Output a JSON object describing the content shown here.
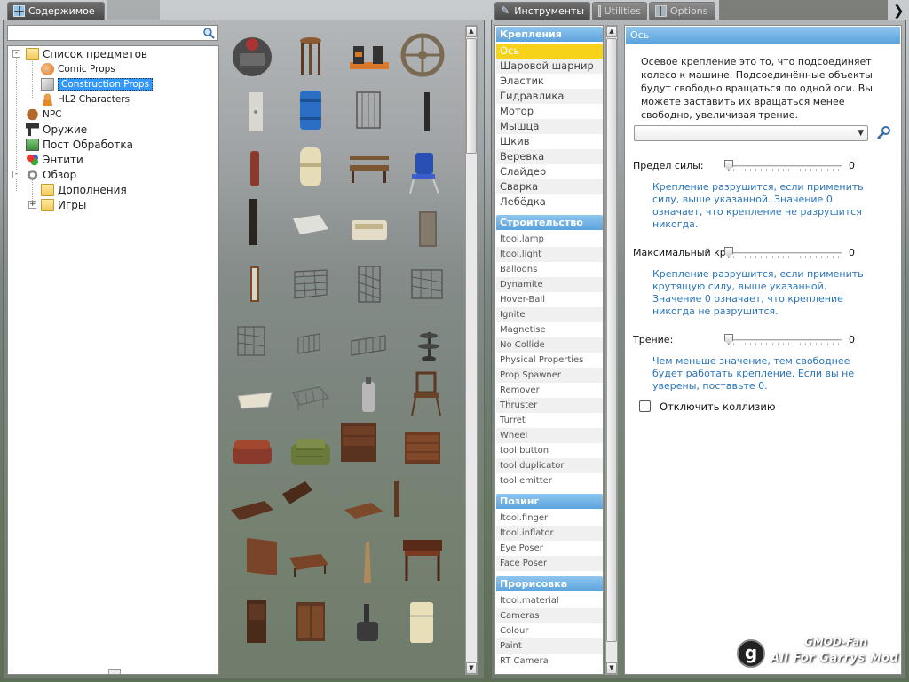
{
  "left_tab": {
    "label": "Содержимое"
  },
  "right_tabs": [
    {
      "label": "Инструменты",
      "active": true
    },
    {
      "label": "Utilities",
      "active": false
    },
    {
      "label": "Options",
      "active": false
    }
  ],
  "search": {
    "value": "",
    "placeholder": ""
  },
  "tree": {
    "items": [
      {
        "label": "Список предметов",
        "icon": "folder-icon",
        "expander": "-"
      },
      {
        "label": "Comic Props",
        "icon": "props-icon"
      },
      {
        "label": "Construction Props",
        "icon": "props-icon",
        "selected": true
      },
      {
        "label": "HL2 Characters",
        "icon": "character-icon"
      },
      {
        "label": "NPC",
        "icon": "npc-icon"
      },
      {
        "label": "Оружие",
        "icon": "weapon-icon"
      },
      {
        "label": "Пост Обработка",
        "icon": "postprocess-icon"
      },
      {
        "label": "Энтити",
        "icon": "entity-icon"
      },
      {
        "label": "Обзор",
        "icon": "gear-icon",
        "expander": "-"
      },
      {
        "label": "Дополнения",
        "icon": "folder-icon"
      },
      {
        "label": "Игры",
        "icon": "folder-icon",
        "expander": "+"
      }
    ]
  },
  "tools": {
    "categories": [
      {
        "title": "Крепления",
        "items": [
          "Ось",
          "Шаровой шарнир",
          "Эластик",
          "Гидравлика",
          "Мотор",
          "Мышца",
          "Шкив",
          "Веревка",
          "Слайдер",
          "Сварка",
          "Лебёдка"
        ]
      },
      {
        "title": "Строительство",
        "items": [
          "ltool.lamp",
          "ltool.light",
          "Balloons",
          "Dynamite",
          "Hover-Ball",
          "Ignite",
          "Magnetise",
          "No Collide",
          "Physical Properties",
          "Prop Spawner",
          "Remover",
          "Thruster",
          "Turret",
          "Wheel",
          "tool.button",
          "tool.duplicator",
          "tool.emitter"
        ]
      },
      {
        "title": "Позинг",
        "items": [
          "ltool.finger",
          "ltool.inflator",
          "Eye Poser",
          "Face Poser"
        ]
      },
      {
        "title": "Прорисовка",
        "items": [
          "ltool.material",
          "Cameras",
          "Colour",
          "Paint",
          "RT Camera"
        ]
      }
    ],
    "selected": "Ось"
  },
  "settings": {
    "title": "Ось",
    "description": "Осевое крепление это то, что подсоединяет колесо к машине. Подсоединённые объекты будут свободно вращаться по одной оси. Вы можете заставить их вращаться менее свободно, увеличивая трение.",
    "dropdown_value": "",
    "sliders": [
      {
        "label": "Предел силы:",
        "value": "0",
        "fraction": 0,
        "help": "Крепление разрушится, если применить силу, выше указанной. Значение 0 означает, что крепление не разрушится никогда."
      },
      {
        "label": "Максимальный кр",
        "value": "0",
        "fraction": 0,
        "help": "Крепление разрушится, если применить крутящую силу, выше указанной. Значение 0 означает, что крепление никогда не разрушится."
      },
      {
        "label": "Трение:",
        "value": "0",
        "fraction": 0,
        "help": "Чем меньше значение, тем свободнее будет работать крепление. Если вы не уверены, поставьте 0."
      }
    ],
    "checkbox": {
      "label": "Отключить коллизию",
      "checked": false
    }
  },
  "watermark": {
    "line1": "GMOD-Fan",
    "line2": "All For Garrys Mod",
    "logo": "g"
  },
  "colors": {
    "accent_blue": "#5ba3dd",
    "selected_yellow": "#f6d21a",
    "help_blue": "#2a74b8",
    "tree_selection": "#3399ff"
  }
}
